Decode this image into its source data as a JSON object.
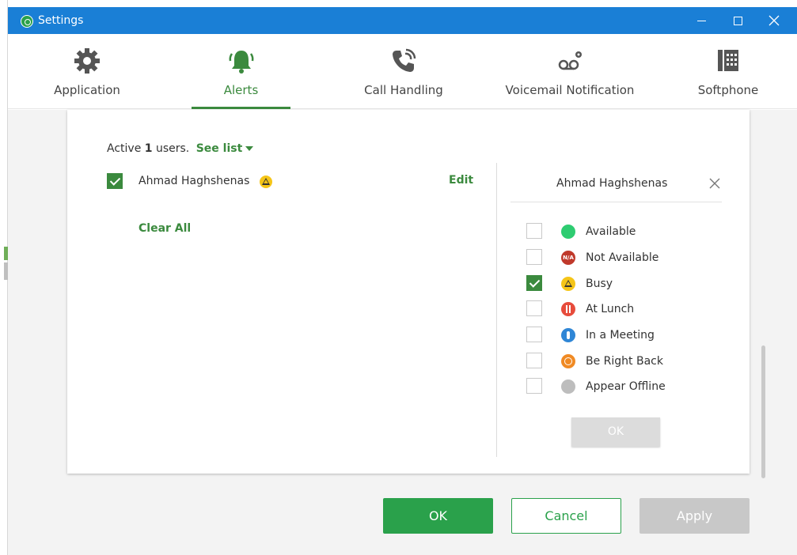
{
  "window": {
    "title": "Settings"
  },
  "tabs": [
    {
      "label": "Application",
      "icon": "gear-icon"
    },
    {
      "label": "Alerts",
      "icon": "bell-icon",
      "active": true
    },
    {
      "label": "Call Handling",
      "icon": "phone-icon"
    },
    {
      "label": "Voicemail Notification",
      "icon": "voicemail-icon"
    },
    {
      "label": "Softphone",
      "icon": "desk-phone-icon"
    }
  ],
  "active_users": {
    "prefix": "Active ",
    "count": "1",
    "suffix": " users.",
    "see_list_label": "See list"
  },
  "user": {
    "name": "Ahmad Haghshenas",
    "checked": true,
    "status_icon": "busy-icon",
    "edit_label": "Edit"
  },
  "clear_all_label": "Clear All",
  "status_panel": {
    "title": "Ahmad Haghshenas",
    "statuses": [
      {
        "label": "Available",
        "checked": false,
        "color": "#2ecc71"
      },
      {
        "label": "Not Available",
        "checked": false,
        "color": "#c0392b",
        "badge": "N/A"
      },
      {
        "label": "Busy",
        "checked": true,
        "color": "#f5c518"
      },
      {
        "label": "At Lunch",
        "checked": false,
        "color": "#e74c3c"
      },
      {
        "label": "In a Meeting",
        "checked": false,
        "color": "#2f86d6"
      },
      {
        "label": "Be Right Back",
        "checked": false,
        "color": "#f08a24"
      },
      {
        "label": "Appear Offline",
        "checked": false,
        "color": "#bdbdbd"
      }
    ],
    "ok_label": "OK"
  },
  "footer": {
    "ok_label": "OK",
    "cancel_label": "Cancel",
    "apply_label": "Apply"
  },
  "colors": {
    "accent": "#3b8a3e",
    "titlebar": "#1a7fd6",
    "primary_button": "#2aa14b"
  }
}
